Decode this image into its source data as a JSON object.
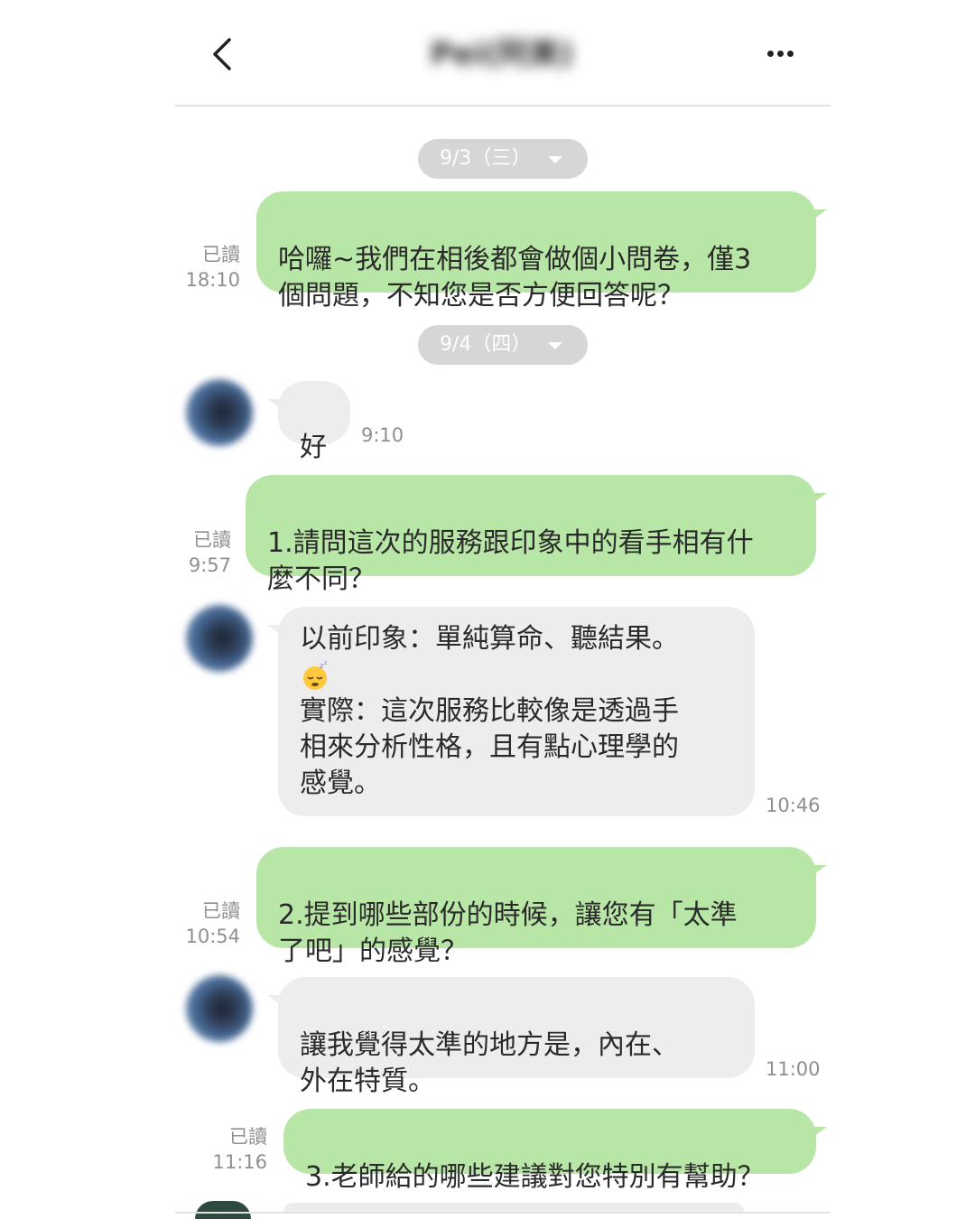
{
  "header": {
    "title": "Pei(阿美)",
    "back_icon": "chevron-left-icon",
    "more_icon": "more-horizontal-icon"
  },
  "colors": {
    "outgoing_bubble": "#b8e6a7",
    "incoming_bubble": "#ededed",
    "date_pill": "#d6d6d6",
    "meta_text": "#8f8f8f"
  },
  "dates": [
    {
      "label": "9/3（三）"
    },
    {
      "label": "9/4（四）"
    }
  ],
  "messages": [
    {
      "direction": "out",
      "text": "哈囉~我們在相後都會做個小問卷，僅3\n個問題，不知您是否方便回答呢？",
      "read": "已讀",
      "time": "18:10"
    },
    {
      "direction": "in",
      "text": "好",
      "time": "9:10"
    },
    {
      "direction": "out",
      "text": "1.請問這次的服務跟印象中的看手相有什\n麼不同？",
      "read": "已讀",
      "time": "9:57"
    },
    {
      "direction": "in",
      "text_before_emoji": "以前印象：單純算命、聽結果。",
      "emoji": "sleepy-face-emoji-icon",
      "text_after_emoji": "實際：這次服務比較像是透過手\n相來分析性格，且有點心理學的\n感覺。",
      "time": "10:46"
    },
    {
      "direction": "out",
      "text": "2.提到哪些部份的時候，讓您有「太準\n了吧」的感覺？",
      "read": "已讀",
      "time": "10:54"
    },
    {
      "direction": "in",
      "text": "讓我覺得太準的地方是，內在、\n外在特質。",
      "time": "11:00"
    },
    {
      "direction": "out",
      "text": "3.老師給的哪些建議對您特別有幫助？",
      "read": "已讀",
      "time": "11:16"
    }
  ]
}
